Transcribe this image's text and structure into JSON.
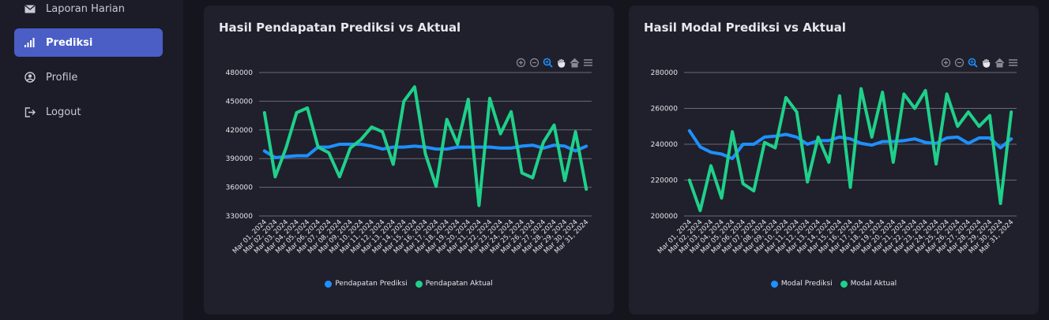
{
  "sidebar": {
    "items": [
      {
        "label": "Laporan Harian",
        "icon": "envelope-icon"
      },
      {
        "label": "Prediksi",
        "icon": "bar-chart-icon",
        "active": true
      },
      {
        "label": "Profile",
        "icon": "user-circle-icon"
      },
      {
        "label": "Logout",
        "icon": "logout-icon"
      }
    ]
  },
  "colors": {
    "accent": "#4a5ec6",
    "prediksi": "#1e90ff",
    "aktual": "#1fd08a"
  },
  "toolbar_icons": [
    "zoom-in-icon",
    "zoom-out-icon",
    "selection-zoom-icon",
    "pan-hand-icon",
    "home-reset-icon",
    "menu-icon"
  ],
  "cards": [
    {
      "title": "Hasil Pendapatan Prediksi vs Aktual",
      "chart_data": {
        "type": "line",
        "x": [
          "Mar 01, 2024",
          "Mar 02, 2024",
          "Mar 03, 2024",
          "Mar 04, 2024",
          "Mar 05, 2024",
          "Mar 06, 2024",
          "Mar 07, 2024",
          "Mar 08, 2024",
          "Mar 09, 2024",
          "Mar 10, 2024",
          "Mar 11, 2024",
          "Mar 12, 2024",
          "Mar 13, 2024",
          "Mar 14, 2024",
          "Mar 15, 2024",
          "Mar 16, 2024",
          "Mar 17, 2024",
          "Mar 18, 2024",
          "Mar 19, 2024",
          "Mar 20, 2024",
          "Mar 21, 2024",
          "Mar 22, 2024",
          "Mar 23, 2024",
          "Mar 24, 2024",
          "Mar 25, 2024",
          "Mar 26, 2024",
          "Mar 27, 2024",
          "Mar 28, 2024",
          "Mar 29, 2024",
          "Mar 30, 2024",
          "Mar 31, 2024"
        ],
        "series": [
          {
            "name": "Pendapatan Prediksi",
            "color": "#1e90ff",
            "values": [
              398000,
              391000,
              392000,
              393000,
              393000,
              402000,
              402000,
              405000,
              405000,
              405000,
              403000,
              400000,
              402000,
              402000,
              403000,
              402000,
              400000,
              400000,
              402000,
              402000,
              402000,
              402000,
              401000,
              401000,
              403000,
              404000,
              401000,
              404000,
              403000,
              398000,
              403000
            ]
          },
          {
            "name": "Pendapatan Aktual",
            "color": "#1fd08a",
            "values": [
              438000,
              371000,
              401000,
              438000,
              443000,
              402000,
              396000,
              371000,
              401000,
              410000,
              423000,
              418000,
              384000,
              450000,
              465000,
              395000,
              361000,
              431000,
              405000,
              452000,
              341000,
              453000,
              416000,
              439000,
              375000,
              370000,
              407000,
              425000,
              367000,
              418000,
              358000
            ]
          }
        ],
        "yticks": [
          "480000",
          "450000",
          "420000",
          "390000",
          "360000",
          "330000"
        ],
        "ylim": [
          330000,
          480000
        ]
      }
    },
    {
      "title": "Hasil Modal Prediksi vs Aktual",
      "chart_data": {
        "type": "line",
        "x": [
          "Mar 01, 2024",
          "Mar 02, 2024",
          "Mar 03, 2024",
          "Mar 04, 2024",
          "Mar 05, 2024",
          "Mar 06, 2024",
          "Mar 07, 2024",
          "Mar 08, 2024",
          "Mar 09, 2024",
          "Mar 10, 2024",
          "Mar 11, 2024",
          "Mar 12, 2024",
          "Mar 13, 2024",
          "Mar 14, 2024",
          "Mar 15, 2024",
          "Mar 16, 2024",
          "Mar 17, 2024",
          "Mar 18, 2024",
          "Mar 19, 2024",
          "Mar 20, 2024",
          "Mar 21, 2024",
          "Mar 22, 2024",
          "Mar 23, 2024",
          "Mar 24, 2024",
          "Mar 25, 2024",
          "Mar 26, 2024",
          "Mar 27, 2024",
          "Mar 28, 2024",
          "Mar 29, 2024",
          "Mar 30, 2024",
          "Mar 31, 2024"
        ],
        "series": [
          {
            "name": "Modal Prediksi",
            "color": "#1e90ff",
            "values": [
              247500,
              238500,
              235500,
              234500,
              232000,
              240000,
              240000,
              244000,
              244500,
              245500,
              244000,
              240000,
              242000,
              242000,
              244000,
              243000,
              240500,
              239500,
              241500,
              241500,
              242000,
              243000,
              241000,
              240500,
              243500,
              244000,
              240500,
              243500,
              243500,
              238000,
              243000
            ]
          },
          {
            "name": "Modal Aktual",
            "color": "#1fd08a",
            "values": [
              220000,
              203000,
              228000,
              210000,
              247000,
              218000,
              214000,
              241000,
              238000,
              266000,
              258000,
              219000,
              244000,
              230000,
              267000,
              216000,
              271000,
              244000,
              269000,
              230000,
              268000,
              260000,
              270000,
              229000,
              268000,
              250000,
              258000,
              250000,
              256000,
              207000,
              258000
            ]
          }
        ],
        "yticks": [
          "280000",
          "260000",
          "240000",
          "220000",
          "200000"
        ],
        "ylim": [
          200000,
          280000
        ]
      }
    }
  ]
}
